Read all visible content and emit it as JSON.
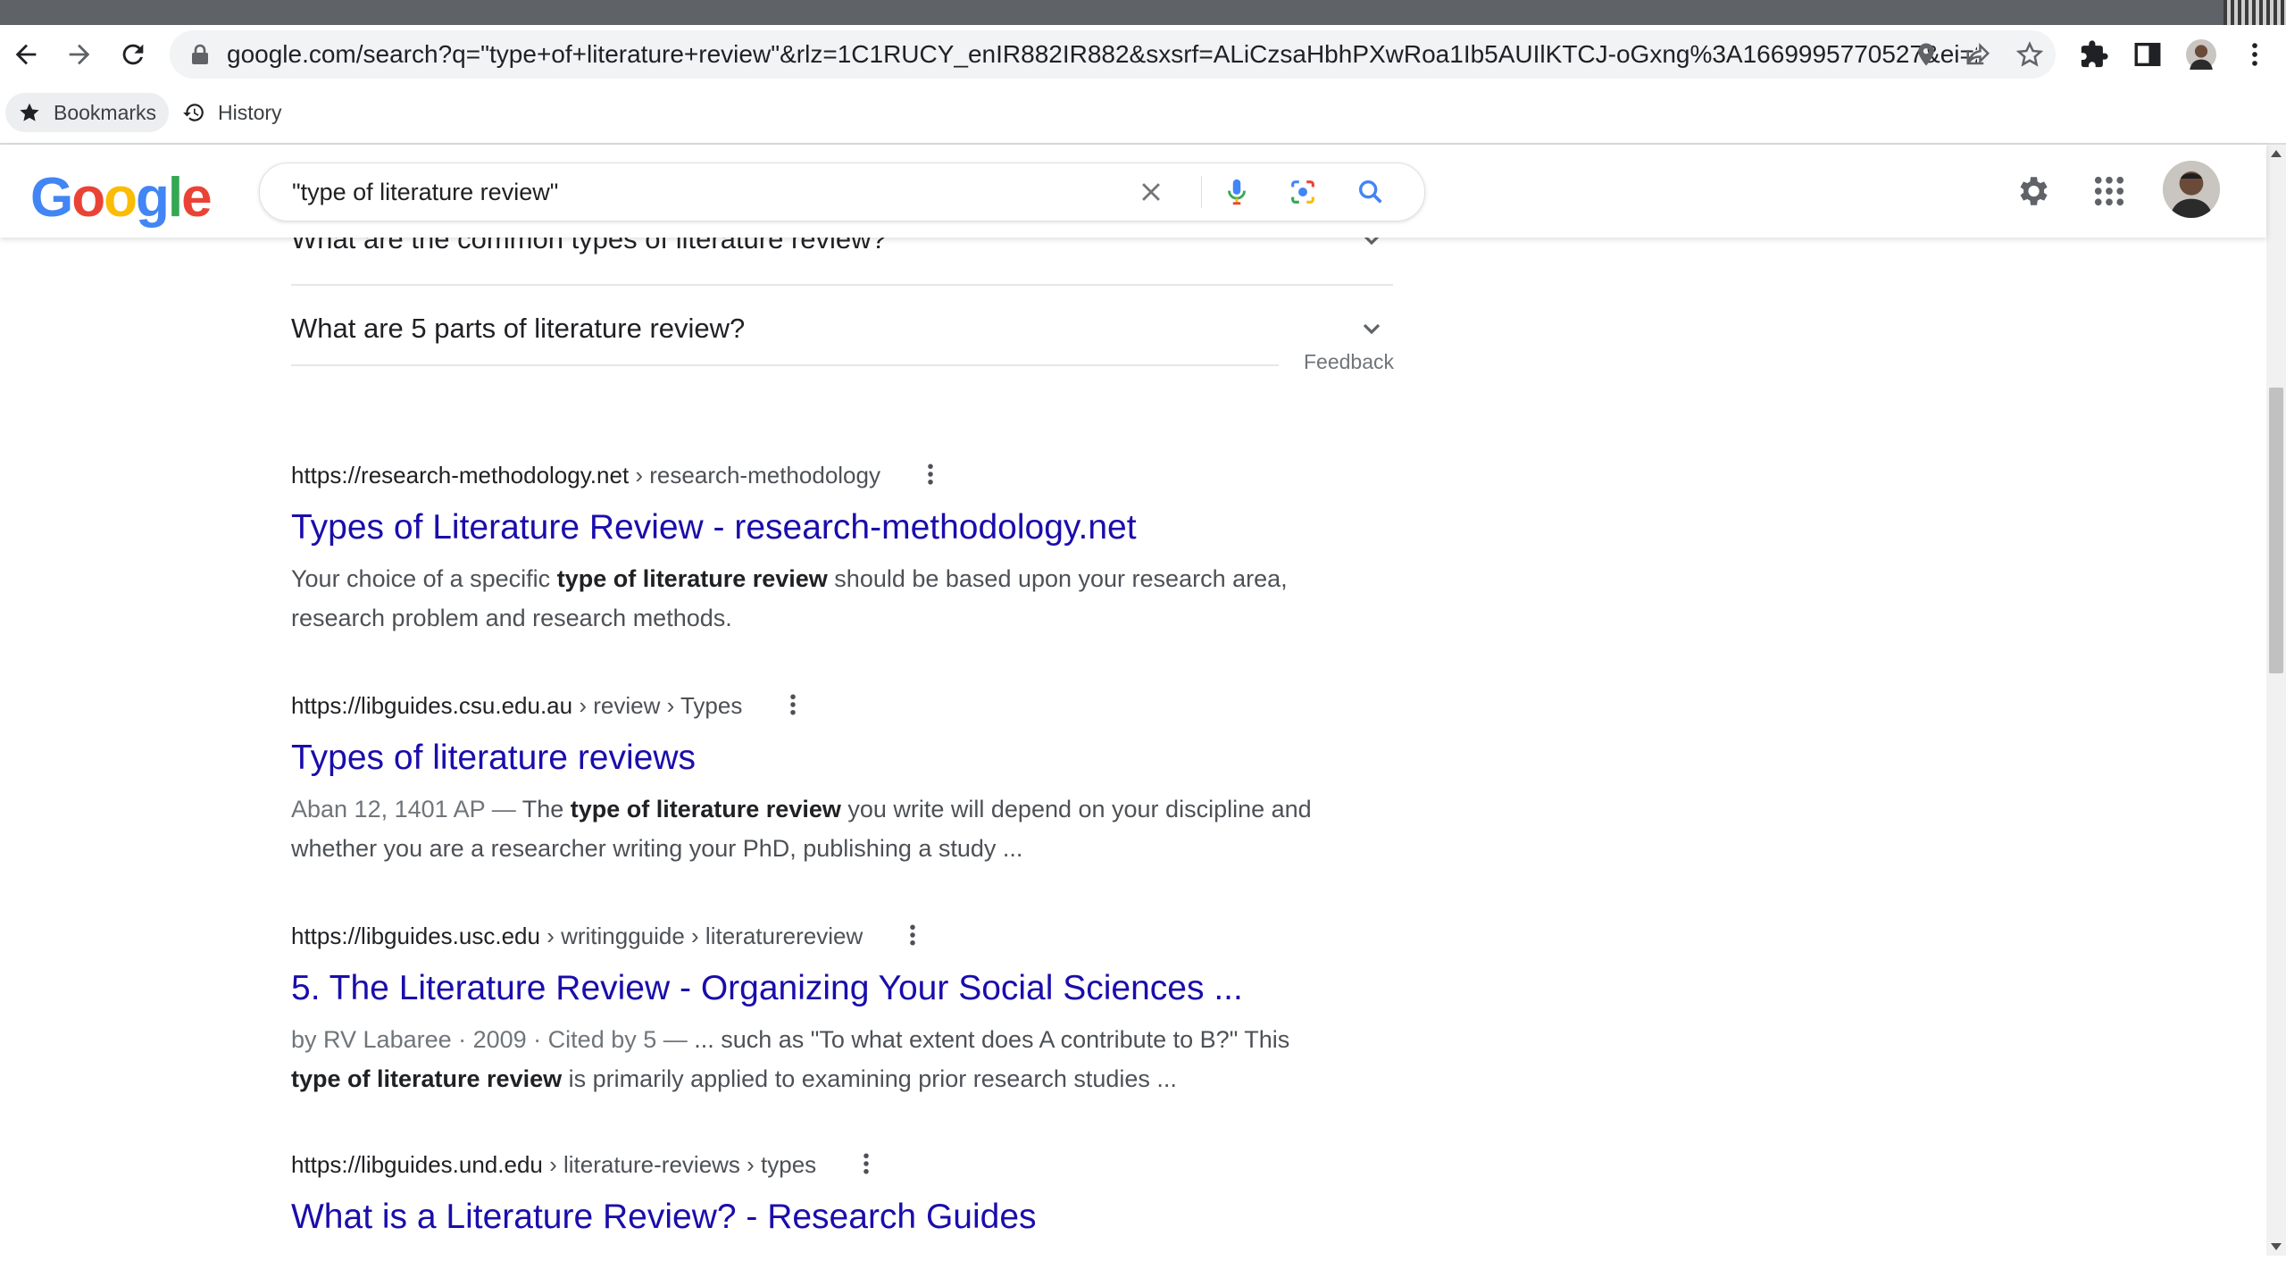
{
  "browser": {
    "url": "google.com/search?q=\"type+of+literature+review\"&rlz=1C1RUCY_enIR882IR882&sxsrf=ALiCzsaHbhPXwRoa1Ib5AUIlKTCJ-oGxng%3A1669995770527&ei=2S...",
    "bookmarks_label": "Bookmarks",
    "history_label": "History"
  },
  "search": {
    "query": "\"type of literature review\""
  },
  "people_also_ask": {
    "prev_question": "What are the common types of literature review?",
    "last_question": "What are 5 parts of literature review?",
    "feedback": "Feedback"
  },
  "results": [
    {
      "domain": "https://research-methodology.net",
      "path": " › research-methodology",
      "title": "Types of Literature Review - research-methodology.net",
      "s1": "Your choice of a specific ",
      "s1b": "type of literature review",
      "s2": " should be based upon your research area, research problem and research methods."
    },
    {
      "domain": "https://libguides.csu.edu.au",
      "path": " › review › Types",
      "title": "Types of literature reviews",
      "date": "Aban 12, 1401 AP — ",
      "s1": "The ",
      "s1b": "type of literature review",
      "s2": " you write will depend on your discipline and whether you are a researcher writing your PhD, publishing a study ..."
    },
    {
      "domain": "https://libguides.usc.edu",
      "path": " › writingguide › literaturereview",
      "title": "5. The Literature Review - Organizing Your Social Sciences ...",
      "date": "by RV Labaree · 2009 · Cited by 5 — ",
      "s1": "... such as \"To what extent does A contribute to B?\" This ",
      "s1b": "type of literature review",
      "s2": " is primarily applied to examining prior research studies ..."
    },
    {
      "domain": "https://libguides.und.edu",
      "path": " › literature-reviews › types",
      "title": "What is a Literature Review? - Research Guides"
    }
  ],
  "colors": {
    "link": "#1a0dab",
    "google_blue": "#4285f4",
    "google_red": "#ea4335",
    "google_yellow": "#fbbc05",
    "google_green": "#34a853"
  }
}
